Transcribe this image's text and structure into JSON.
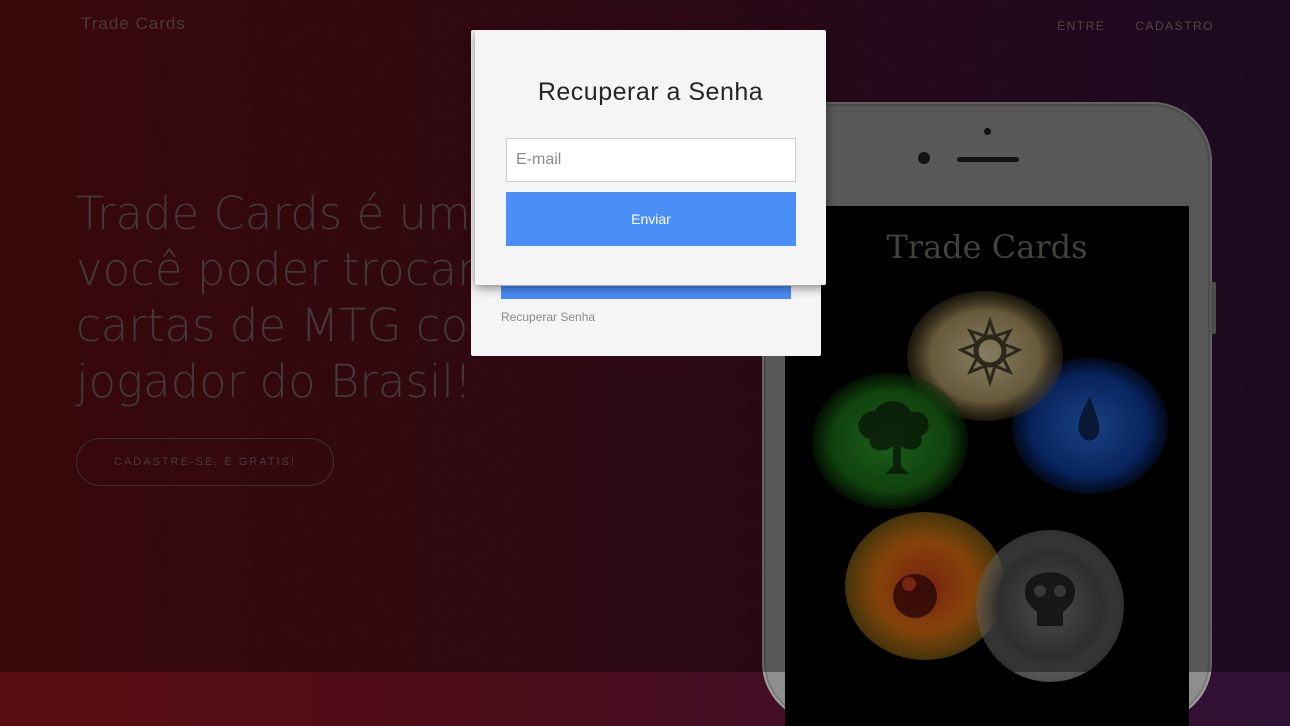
{
  "header": {
    "brand": "Trade Cards",
    "nav": [
      {
        "label": "ENTRE"
      },
      {
        "label": "CADASTRO"
      }
    ]
  },
  "hero": {
    "headline": "Trade Cards é um site para você poder trocar as suas cartas de MTG com qualquer jogador do Brasil!",
    "cta_label": "CADASTRE-SE, É GRATIS!"
  },
  "phone": {
    "screen_title": "Trade Cards",
    "art": [
      "white-sun-mana-icon",
      "blue-drop-mana-icon",
      "green-tree-mana-icon",
      "red-fire-mana-icon",
      "black-skull-mana-icon"
    ]
  },
  "login_modal": {
    "forgot_password_link": "Recuperar Senha"
  },
  "recover_modal": {
    "title": "Recuperar a Senha",
    "email_placeholder": "E-mail",
    "email_value": "",
    "submit_label": "Enviar"
  },
  "colors": {
    "accent_button": "#4a8ef8",
    "modal_bg": "#f5f5f5"
  }
}
